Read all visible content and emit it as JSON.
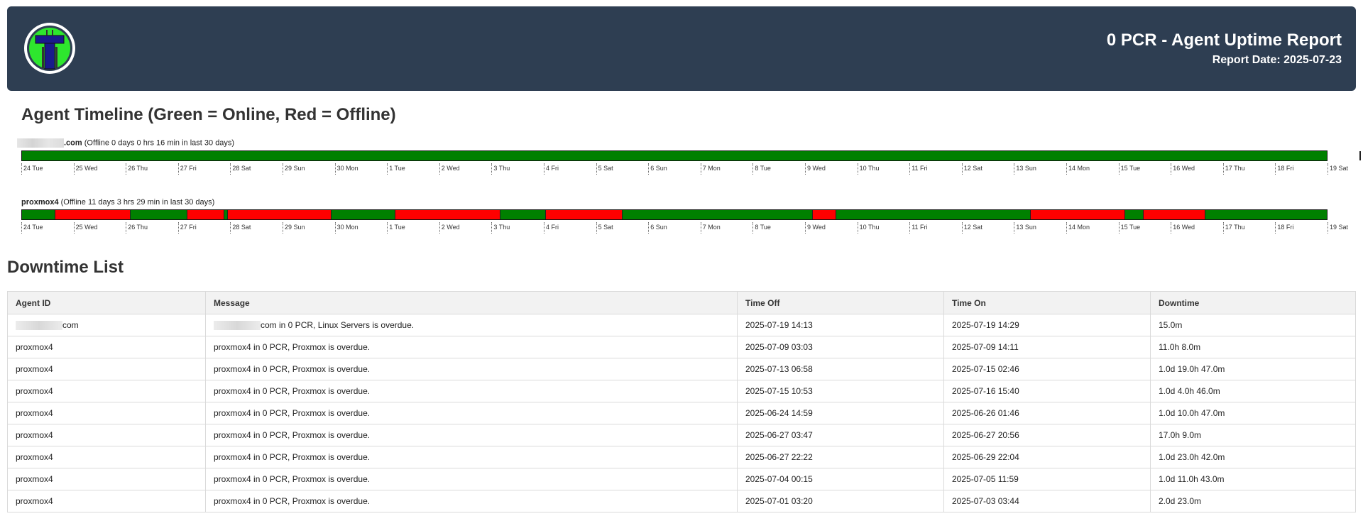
{
  "header": {
    "title": "0 PCR - Agent Uptime Report",
    "date": "Report Date: 2025-07-23",
    "logo_icon": "t-letter-logo-icon"
  },
  "timeline": {
    "title": "Agent Timeline (Green = Online, Red = Offline)",
    "colors": {
      "online": "#008000",
      "offline": "#ff0000"
    },
    "day_ticks": [
      "24 Tue",
      "25 Wed",
      "26 Thu",
      "27 Fri",
      "28 Sat",
      "29 Sun",
      "30 Mon",
      "1 Tue",
      "2 Wed",
      "3 Thu",
      "4 Fri",
      "5 Sat",
      "6 Sun",
      "7 Mon",
      "8 Tue",
      "9 Wed",
      "10 Thu",
      "11 Fri",
      "12 Sat",
      "13 Sun",
      "14 Mon",
      "15 Tue",
      "16 Wed",
      "17 Thu",
      "18 Fri",
      "19 Sat"
    ],
    "agents": [
      {
        "name_suffix": ".com",
        "summary": "(Offline 0 days 0 hrs 16 min in last 30 days)",
        "offline_periods": [
          {
            "from": "2025-07-19 14:13",
            "to": "2025-07-19 14:29"
          }
        ]
      },
      {
        "name": "proxmox4",
        "summary": "(Offline 11 days 3 hrs 29 min in last 30 days)",
        "offline_periods": [
          {
            "from": "2025-06-24 14:59",
            "to": "2025-06-26 01:46"
          },
          {
            "from": "2025-06-27 03:47",
            "to": "2025-06-27 20:56"
          },
          {
            "from": "2025-06-27 22:22",
            "to": "2025-06-29 22:04"
          },
          {
            "from": "2025-07-01 03:20",
            "to": "2025-07-03 03:44"
          },
          {
            "from": "2025-07-04 00:15",
            "to": "2025-07-05 11:59"
          },
          {
            "from": "2025-07-09 03:03",
            "to": "2025-07-09 14:11"
          },
          {
            "from": "2025-07-13 06:58",
            "to": "2025-07-15 02:46"
          },
          {
            "from": "2025-07-15 10:53",
            "to": "2025-07-16 15:40"
          }
        ]
      }
    ]
  },
  "downtime": {
    "title": "Downtime List",
    "columns": [
      "Agent ID",
      "Message",
      "Time Off",
      "Time On",
      "Downtime"
    ],
    "rows": [
      {
        "agent": "com",
        "message": "com in 0 PCR, Linux Servers is overdue.",
        "off": "2025-07-19 14:13",
        "on": "2025-07-19 14:29",
        "downtime": "15.0m",
        "redacted": true
      },
      {
        "agent": "proxmox4",
        "message": "proxmox4 in 0 PCR, Proxmox is overdue.",
        "off": "2025-07-09 03:03",
        "on": "2025-07-09 14:11",
        "downtime": "11.0h 8.0m"
      },
      {
        "agent": "proxmox4",
        "message": "proxmox4 in 0 PCR, Proxmox is overdue.",
        "off": "2025-07-13 06:58",
        "on": "2025-07-15 02:46",
        "downtime": "1.0d 19.0h 47.0m"
      },
      {
        "agent": "proxmox4",
        "message": "proxmox4 in 0 PCR, Proxmox is overdue.",
        "off": "2025-07-15 10:53",
        "on": "2025-07-16 15:40",
        "downtime": "1.0d 4.0h 46.0m"
      },
      {
        "agent": "proxmox4",
        "message": "proxmox4 in 0 PCR, Proxmox is overdue.",
        "off": "2025-06-24 14:59",
        "on": "2025-06-26 01:46",
        "downtime": "1.0d 10.0h 47.0m"
      },
      {
        "agent": "proxmox4",
        "message": "proxmox4 in 0 PCR, Proxmox is overdue.",
        "off": "2025-06-27 03:47",
        "on": "2025-06-27 20:56",
        "downtime": "17.0h 9.0m"
      },
      {
        "agent": "proxmox4",
        "message": "proxmox4 in 0 PCR, Proxmox is overdue.",
        "off": "2025-06-27 22:22",
        "on": "2025-06-29 22:04",
        "downtime": "1.0d 23.0h 42.0m"
      },
      {
        "agent": "proxmox4",
        "message": "proxmox4 in 0 PCR, Proxmox is overdue.",
        "off": "2025-07-04 00:15",
        "on": "2025-07-05 11:59",
        "downtime": "1.0d 11.0h 43.0m"
      },
      {
        "agent": "proxmox4",
        "message": "proxmox4 in 0 PCR, Proxmox is overdue.",
        "off": "2025-07-01 03:20",
        "on": "2025-07-03 03:44",
        "downtime": "2.0d 23.0m"
      }
    ]
  }
}
